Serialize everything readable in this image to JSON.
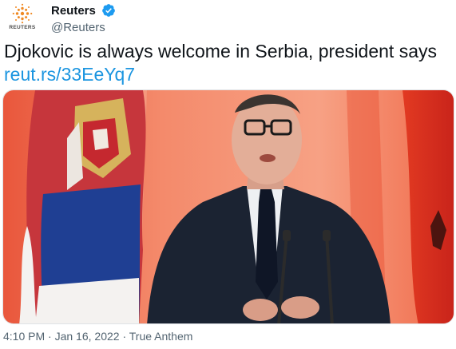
{
  "author": {
    "logo_text": "REUTERS",
    "display_name": "Reuters",
    "handle": "@Reuters",
    "verified": true
  },
  "tweet": {
    "text": "Djokovic is always welcome in Serbia, president says",
    "link": "reut.rs/33EeYq7",
    "media_description_icon": "photo",
    "time": "4:10 PM",
    "separator": " · ",
    "date": "Jan 16, 2022",
    "source": "True Anthem"
  },
  "colors": {
    "link": "#1b95e0",
    "verified": "#1d9bf0",
    "meta": "#536471",
    "logo_accent": "#f08a24"
  }
}
